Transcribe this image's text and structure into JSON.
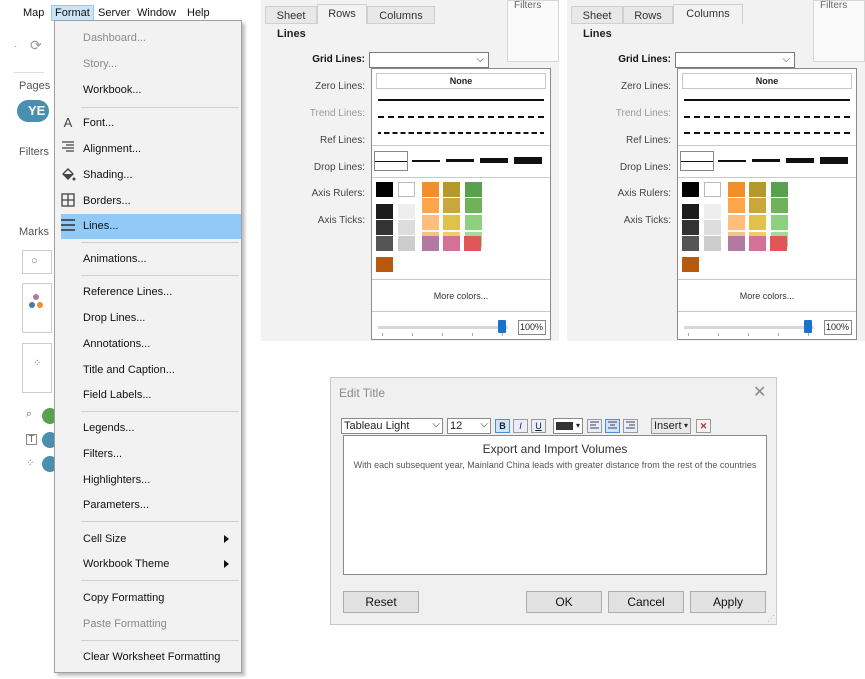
{
  "menubar": {
    "items": [
      "Map",
      "Format",
      "Server",
      "Window",
      "Help"
    ]
  },
  "background": {
    "pages_label": "Pages",
    "year_pill": "YE",
    "filters_label": "Filters",
    "marks_label": "Marks"
  },
  "format_menu": {
    "items": [
      {
        "label": "Dashboard...",
        "disabled": true
      },
      {
        "label": "Story...",
        "disabled": true
      },
      {
        "label": "Workbook..."
      },
      {
        "label": "Font...",
        "icon": "A"
      },
      {
        "label": "Alignment...",
        "icon": "alignment"
      },
      {
        "label": "Shading...",
        "icon": "paint-bucket"
      },
      {
        "label": "Borders...",
        "icon": "borders"
      },
      {
        "label": "Lines...",
        "icon": "lines",
        "highlighted": true
      },
      {
        "label": "Animations..."
      },
      {
        "label": "Reference Lines..."
      },
      {
        "label": "Drop Lines..."
      },
      {
        "label": "Annotations..."
      },
      {
        "label": "Title and Caption..."
      },
      {
        "label": "Field Labels..."
      },
      {
        "label": "Legends..."
      },
      {
        "label": "Filters..."
      },
      {
        "label": "Highlighters..."
      },
      {
        "label": "Parameters..."
      },
      {
        "label": "Cell Size",
        "submenu": true
      },
      {
        "label": "Workbook Theme",
        "submenu": true
      },
      {
        "label": "Copy Formatting"
      },
      {
        "label": "Paste Formatting",
        "disabled": true
      },
      {
        "label": "Clear Worksheet Formatting"
      }
    ]
  },
  "format_panels": [
    {
      "tabs": [
        "Sheet",
        "Rows",
        "Columns"
      ],
      "active_tab": "Rows",
      "filters_label": "Filters",
      "section": "Lines",
      "rows": [
        "Grid Lines:",
        "Zero Lines:",
        "Trend Lines:",
        "Ref Lines:",
        "Drop Lines:",
        "Axis Rulers:",
        "Axis Ticks:"
      ],
      "popup": {
        "none_label": "None",
        "more_colors": "More colors...",
        "opacity": "100%"
      }
    },
    {
      "tabs": [
        "Sheet",
        "Rows",
        "Columns"
      ],
      "active_tab": "Columns",
      "filters_label": "Filters",
      "section": "Lines",
      "rows": [
        "Grid Lines:",
        "Zero Lines:",
        "Trend Lines:",
        "Ref Lines:",
        "Drop Lines:",
        "Axis Rulers:",
        "Axis Ticks:"
      ],
      "popup": {
        "none_label": "None",
        "more_colors": "More colors...",
        "opacity": "100%"
      }
    }
  ],
  "palette": {
    "top_row": [
      "#000000",
      "#ffffff",
      "#f28e2b",
      "#b6992d",
      "#59a14f"
    ],
    "col_dark": [
      "#1c1c1c",
      "#333333",
      "#555555"
    ],
    "col_light": [
      "#eeeeee",
      "#dddddd",
      "#cccccc"
    ],
    "col_orange": [
      "#ffa54a",
      "#ffbe7d",
      "#f7c27d"
    ],
    "col_olive": [
      "#c9a73a",
      "#e0c24b",
      "#f1ce63"
    ],
    "col_green": [
      "#6fb25a",
      "#8cd17d",
      "#a7d89b"
    ],
    "bottom_row": [
      "#b07aa1",
      "#d37295",
      "#e15759"
    ],
    "extra": "#b85a0d"
  },
  "edit_title": {
    "title": "Edit Title",
    "font_family": "Tableau Light",
    "font_size": "12",
    "insert_label": "Insert",
    "line1": "Export and Import Volumes",
    "line2": "With each subsequent year, Mainland China leads with greater distance from the rest of the countries",
    "buttons": [
      "Reset",
      "OK",
      "Cancel",
      "Apply"
    ]
  }
}
